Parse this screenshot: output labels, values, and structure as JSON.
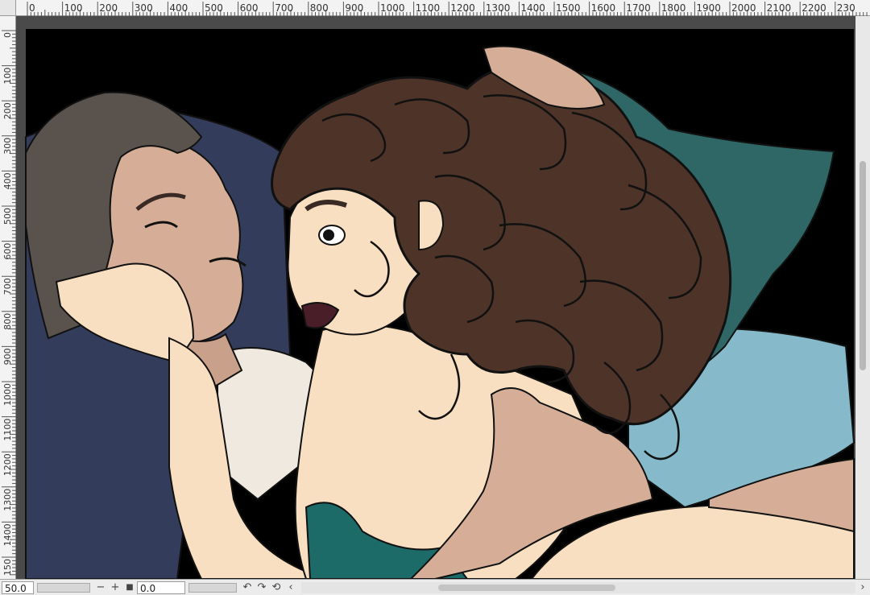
{
  "rulers": {
    "top_ticks": [
      "0",
      "100",
      "200",
      "300",
      "400",
      "500",
      "600",
      "700",
      "800",
      "900",
      "1000",
      "1100",
      "1200",
      "1300",
      "1400",
      "1500",
      "1600",
      "1700",
      "1800",
      "1900",
      "2000",
      "2100",
      "2200",
      "230"
    ],
    "left_ticks": [
      "0",
      "100",
      "200",
      "300",
      "400",
      "500",
      "600",
      "700",
      "800",
      "900",
      "1000",
      "1100",
      "1200",
      "1300",
      "1400",
      "150"
    ]
  },
  "statusbar": {
    "zoom_value": "50.0",
    "rotation_value": "0.0",
    "zoom_out_symbol": "−",
    "zoom_in_symbol": "+",
    "fit_symbol": "■",
    "undo_icon": "undo-icon",
    "redo_icon": "redo-icon",
    "reset_icon": "reset-rotation-icon",
    "scroll_left_symbol": "‹",
    "scroll_right_symbol": "›"
  },
  "colors": {
    "background": "#000000",
    "pillow_dark": "#343c5c",
    "pillow_teal": "#2e6766",
    "pillow_light": "#86bacb",
    "hair_brown": "#4e3329",
    "man_hair": "#5a524d",
    "man_skin": "#d6ae97",
    "woman_skin": "#f9dfc1",
    "dress_teal": "#1c6b68",
    "shirt": "#efe9df"
  }
}
